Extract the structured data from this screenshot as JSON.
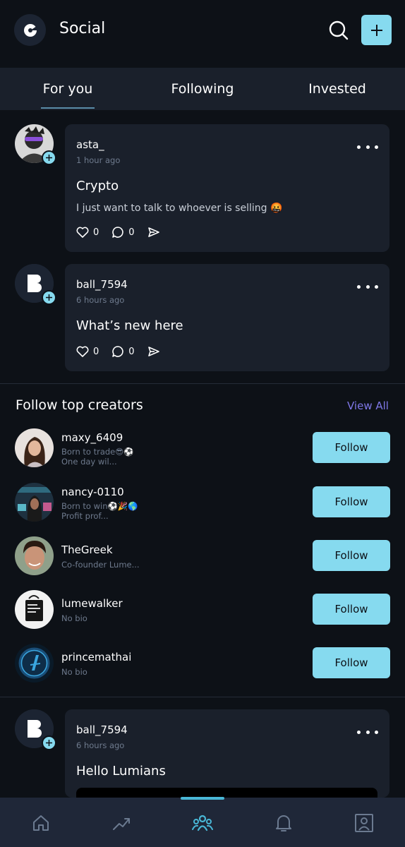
{
  "header": {
    "title": "Social",
    "search_icon": "search-icon",
    "add_icon": "plus-icon",
    "accent": "#86daef"
  },
  "tabs": [
    {
      "label": "For you",
      "active": true
    },
    {
      "label": "Following",
      "active": false
    },
    {
      "label": "Invested",
      "active": false
    }
  ],
  "posts": [
    {
      "username": "asta_",
      "time": "1 hour ago",
      "title": "Crypto",
      "body": "I just want to talk to whoever is selling 🤬",
      "likes": "0",
      "comments": "0"
    },
    {
      "username": "ball_7594",
      "time": "6 hours ago",
      "title": "What’s new here",
      "likes": "0",
      "comments": "0"
    },
    {
      "username": "ball_7594",
      "time": "6 hours ago",
      "title": "Hello Lumians"
    }
  ],
  "creators_section": {
    "title": "Follow top creators",
    "view_all": "View All",
    "view_all_color": "#7f78e8",
    "follow_label": "Follow",
    "items": [
      {
        "name": "maxy_6409",
        "bio_line1": "Born to trade😎⚽",
        "bio_line2": "One day wil..."
      },
      {
        "name": "nancy-0110",
        "bio_line1": "Born to win⚽🎉🌎",
        "bio_line2": "Profit prof..."
      },
      {
        "name": "TheGreek",
        "bio_line1": "Co-founder Lume..."
      },
      {
        "name": "lumewalker",
        "bio_line1": "No bio"
      },
      {
        "name": "princemathai",
        "bio_line1": "No bio"
      }
    ]
  },
  "bottom_nav": [
    {
      "icon": "home-icon"
    },
    {
      "icon": "trending-icon"
    },
    {
      "icon": "community-icon",
      "active": true
    },
    {
      "icon": "bell-icon"
    },
    {
      "icon": "profile-icon"
    }
  ]
}
